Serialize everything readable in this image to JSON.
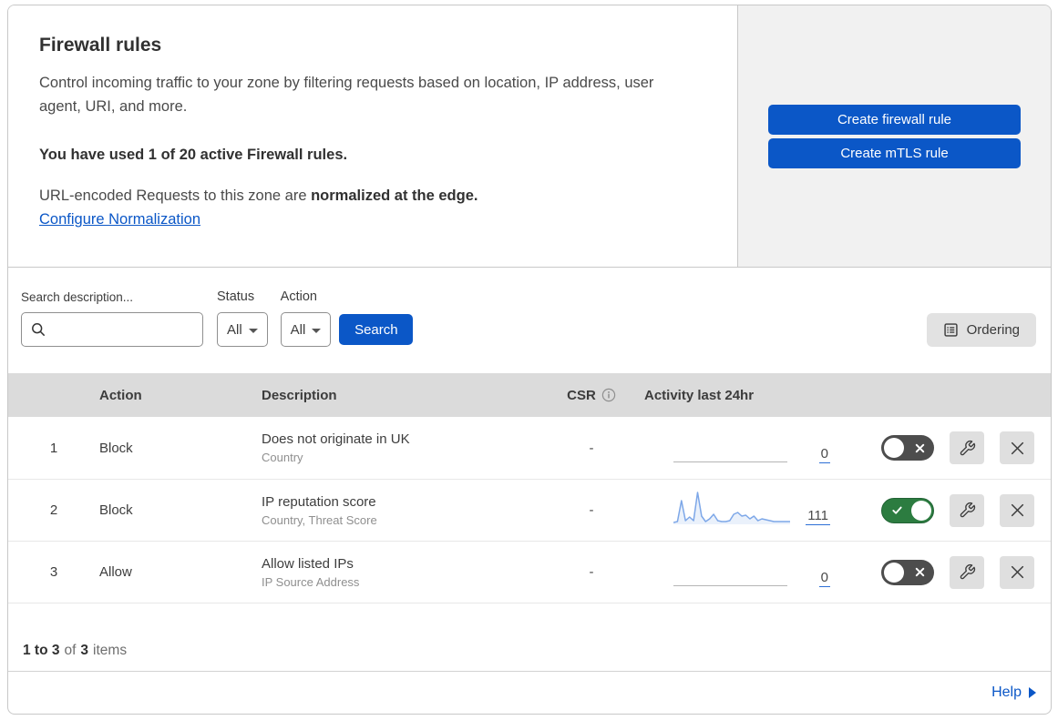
{
  "header": {
    "title": "Firewall rules",
    "description": "Control incoming traffic to your zone by filtering requests based on location, IP address, user agent, URI, and more.",
    "usage_line": "You have used 1 of 20 active Firewall rules.",
    "normalization_text": "URL-encoded Requests to this zone are ",
    "normalization_bold": "normalized at the edge.",
    "normalization_link": "Configure Normalization",
    "create_firewall_button": "Create firewall rule",
    "create_mtls_button": "Create mTLS rule"
  },
  "filters": {
    "search_label": "Search description...",
    "status_label": "Status",
    "status_value": "All",
    "action_label": "Action",
    "action_value": "All",
    "search_button": "Search",
    "ordering_button": "Ordering"
  },
  "table": {
    "columns": {
      "action": "Action",
      "description": "Description",
      "csr": "CSR",
      "activity": "Activity last 24hr"
    },
    "rows": [
      {
        "priority": "1",
        "action": "Block",
        "description": "Does not originate in UK",
        "fields": "Country",
        "csr": "-",
        "activity_count": "0",
        "enabled": false,
        "has_sparkline": false,
        "sparkline": []
      },
      {
        "priority": "2",
        "action": "Block",
        "description": "IP reputation score",
        "fields": "Country, Threat Score",
        "csr": "-",
        "activity_count": "111",
        "enabled": true,
        "has_sparkline": true,
        "sparkline": [
          1,
          2,
          25,
          3,
          7,
          3,
          34,
          8,
          2,
          5,
          10,
          3,
          2,
          2,
          3,
          10,
          12,
          8,
          9,
          5,
          8,
          3,
          5,
          4,
          3,
          2,
          2,
          2,
          2,
          2
        ]
      },
      {
        "priority": "3",
        "action": "Allow",
        "description": "Allow listed IPs",
        "fields": "IP Source Address",
        "csr": "-",
        "activity_count": "0",
        "enabled": false,
        "has_sparkline": false,
        "sparkline": []
      }
    ]
  },
  "footer": {
    "range": "1 to 3",
    "of": "of",
    "total": "3",
    "items": "items",
    "help": "Help"
  },
  "colors": {
    "accent_blue": "#0b57c7",
    "toggle_on_green": "#2c7c40",
    "toggle_off_grey": "#4d4d4d",
    "sparkline_blue": "#7da7e8",
    "panel_grey": "#f1f1f1",
    "table_header_grey": "#dbdbdb"
  }
}
